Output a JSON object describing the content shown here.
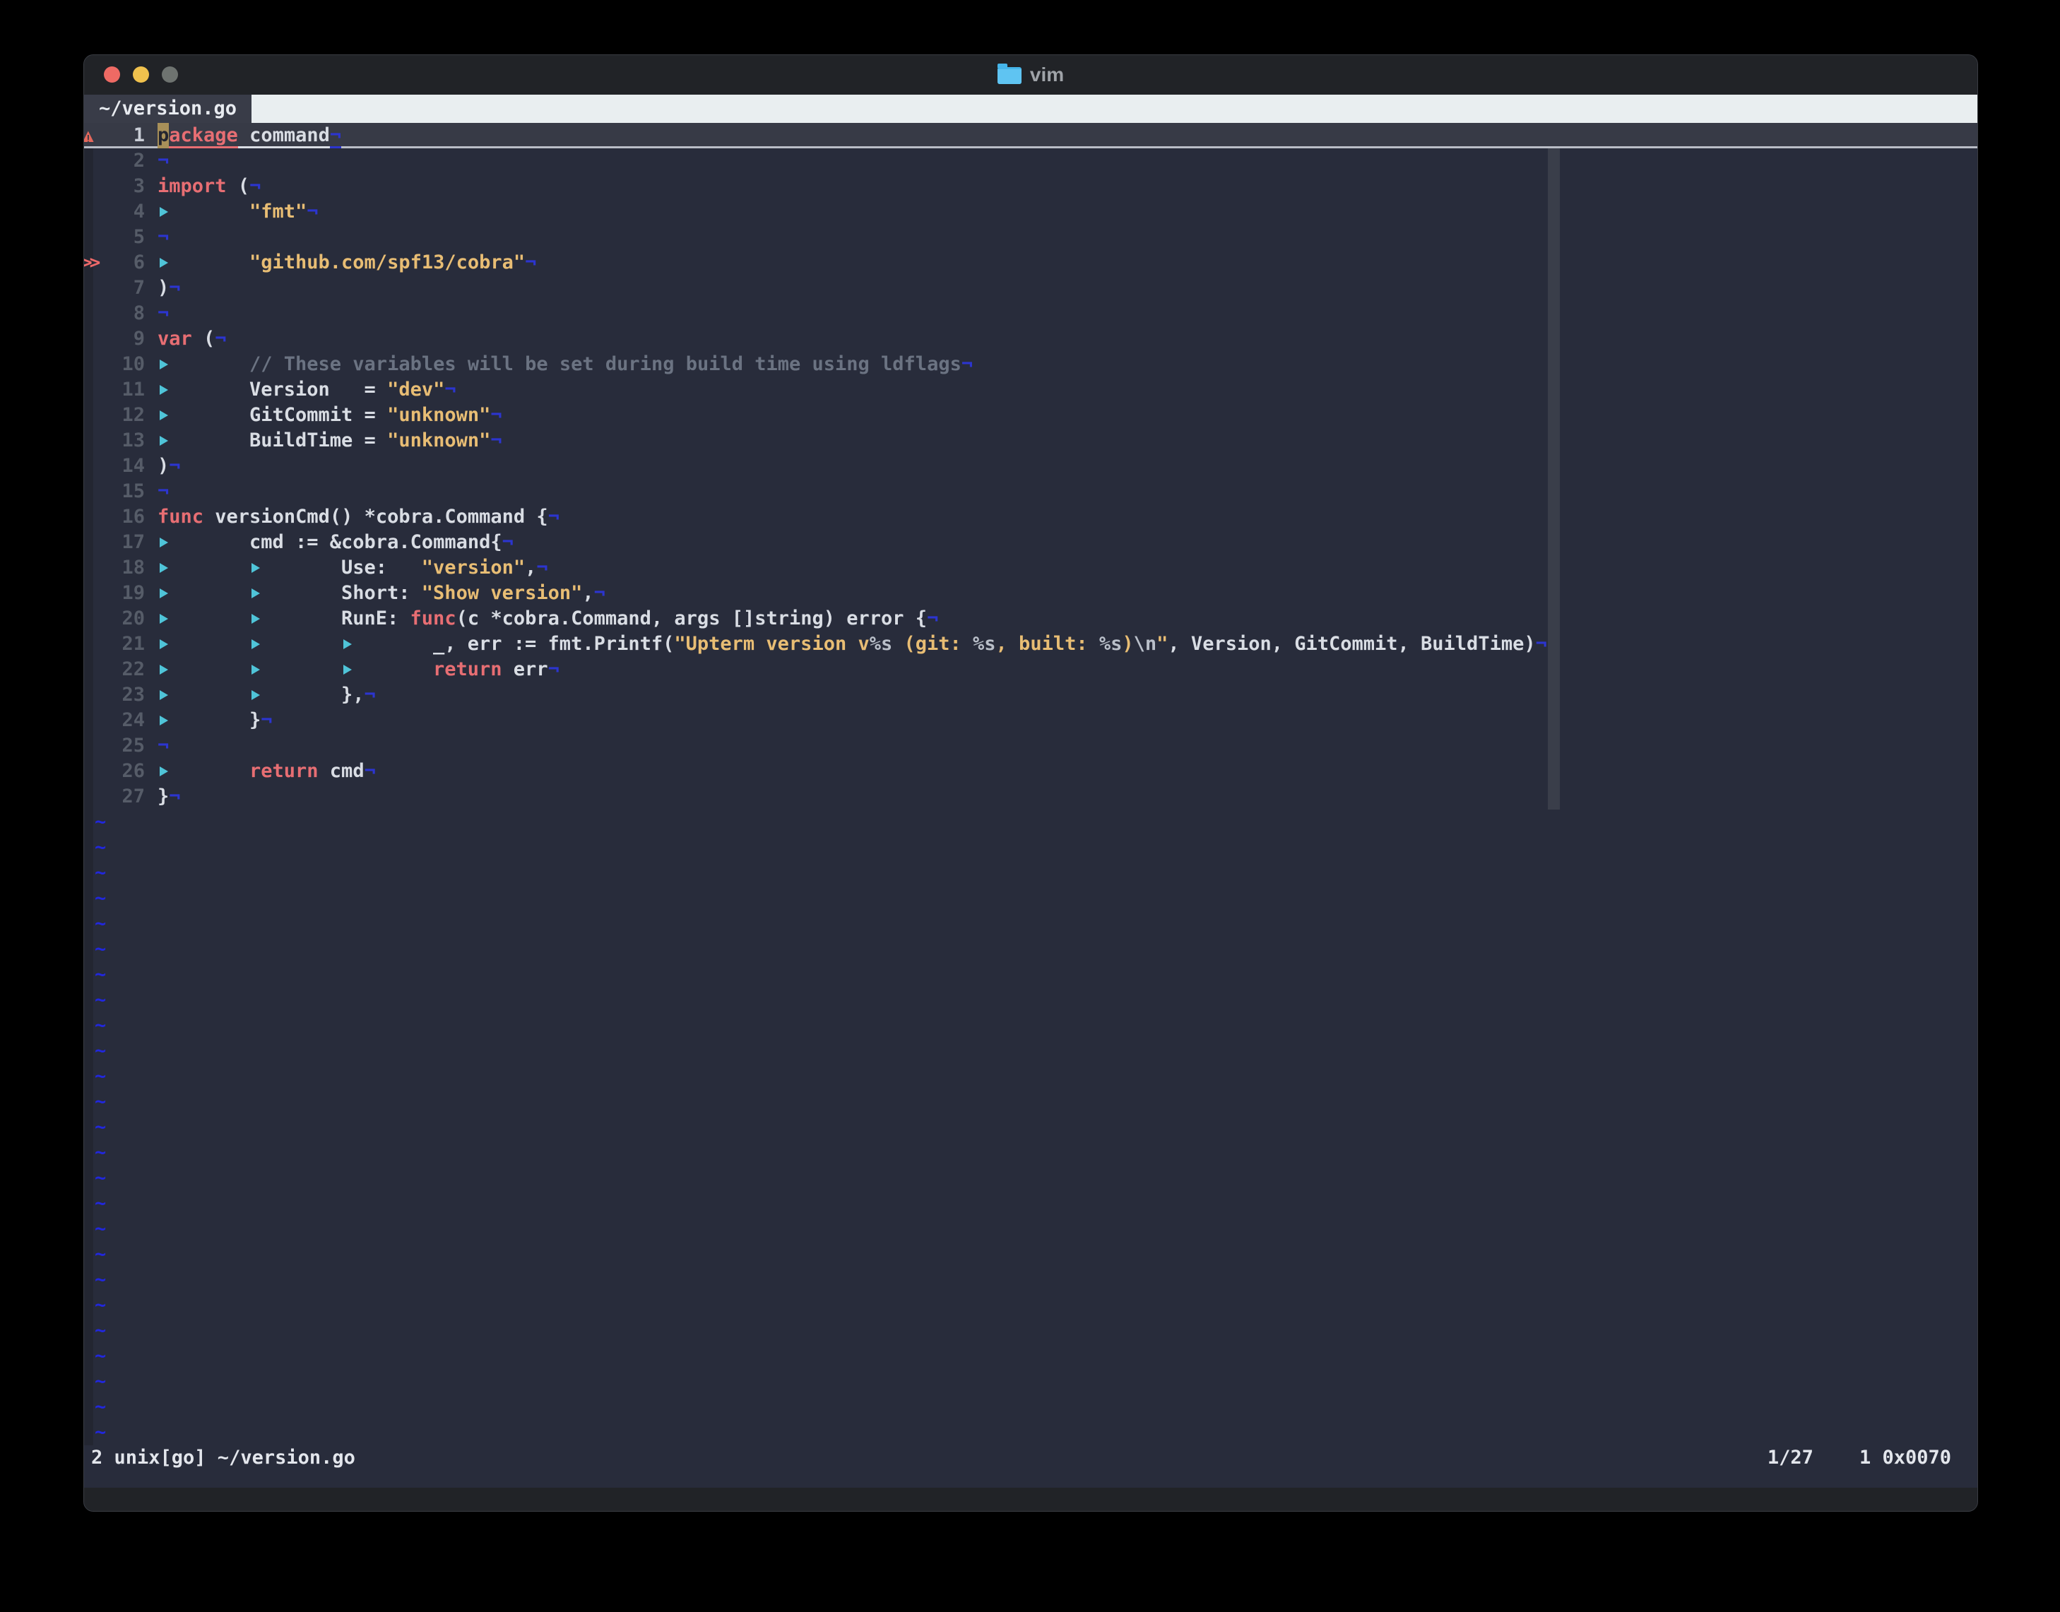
{
  "window": {
    "app_title": "vim",
    "traffic_lights": {
      "close": "#ee6a64",
      "minimize": "#f0c14d",
      "zoom": "#6e7370"
    }
  },
  "tabbar": {
    "active_tab": "~/version.go"
  },
  "statusline": {
    "left": "2 unix[go] ~/version.go",
    "right": "1/27    1 0x0070"
  },
  "editor": {
    "eol_marker": "¬",
    "tab_marker": "tab-indent-triangle",
    "empty_line_marker": "~",
    "empty_rows": 25,
    "signs": {
      "warning_line": 1,
      "changed_line": 6,
      "changed_glyph": ">>"
    },
    "lines": [
      {
        "num": 1,
        "tabs": 0,
        "cursorline": true,
        "sign": "warning",
        "segments": [
          {
            "t": "p",
            "s": "cursor"
          },
          {
            "t": "ackage",
            "s": "keyword"
          },
          {
            "t": " command",
            "s": "normal"
          }
        ]
      },
      {
        "num": 2,
        "tabs": 0,
        "segments": []
      },
      {
        "num": 3,
        "tabs": 0,
        "segments": [
          {
            "t": "import ",
            "s": "keyword"
          },
          {
            "t": "(",
            "s": "normal"
          }
        ]
      },
      {
        "num": 4,
        "tabs": 1,
        "segments": [
          {
            "t": "\"fmt\"",
            "s": "string"
          }
        ]
      },
      {
        "num": 5,
        "tabs": 0,
        "segments": []
      },
      {
        "num": 6,
        "tabs": 1,
        "sign": "changed",
        "segments": [
          {
            "t": "\"github.com/spf13/cobra\"",
            "s": "string"
          }
        ]
      },
      {
        "num": 7,
        "tabs": 0,
        "segments": [
          {
            "t": ")",
            "s": "normal"
          }
        ]
      },
      {
        "num": 8,
        "tabs": 0,
        "segments": []
      },
      {
        "num": 9,
        "tabs": 0,
        "segments": [
          {
            "t": "var ",
            "s": "keyword"
          },
          {
            "t": "(",
            "s": "normal"
          }
        ]
      },
      {
        "num": 10,
        "tabs": 1,
        "segments": [
          {
            "t": "// These variables will be set during build time using ldflags",
            "s": "comment"
          }
        ]
      },
      {
        "num": 11,
        "tabs": 1,
        "segments": [
          {
            "t": "Version   = ",
            "s": "normal"
          },
          {
            "t": "\"dev\"",
            "s": "string"
          }
        ]
      },
      {
        "num": 12,
        "tabs": 1,
        "segments": [
          {
            "t": "GitCommit = ",
            "s": "normal"
          },
          {
            "t": "\"unknown\"",
            "s": "string"
          }
        ]
      },
      {
        "num": 13,
        "tabs": 1,
        "segments": [
          {
            "t": "BuildTime = ",
            "s": "normal"
          },
          {
            "t": "\"unknown\"",
            "s": "string"
          }
        ]
      },
      {
        "num": 14,
        "tabs": 0,
        "segments": [
          {
            "t": ")",
            "s": "normal"
          }
        ]
      },
      {
        "num": 15,
        "tabs": 0,
        "segments": []
      },
      {
        "num": 16,
        "tabs": 0,
        "segments": [
          {
            "t": "func",
            "s": "keyword"
          },
          {
            "t": " versionCmd() *cobra.Command {",
            "s": "normal"
          }
        ]
      },
      {
        "num": 17,
        "tabs": 1,
        "segments": [
          {
            "t": "cmd := &cobra.Command{",
            "s": "normal"
          }
        ]
      },
      {
        "num": 18,
        "tabs": 2,
        "segments": [
          {
            "t": "Use:   ",
            "s": "normal"
          },
          {
            "t": "\"version\"",
            "s": "string"
          },
          {
            "t": ",",
            "s": "normal"
          }
        ]
      },
      {
        "num": 19,
        "tabs": 2,
        "segments": [
          {
            "t": "Short: ",
            "s": "normal"
          },
          {
            "t": "\"Show version\"",
            "s": "string"
          },
          {
            "t": ",",
            "s": "normal"
          }
        ]
      },
      {
        "num": 20,
        "tabs": 2,
        "segments": [
          {
            "t": "RunE: ",
            "s": "normal"
          },
          {
            "t": "func",
            "s": "keyword"
          },
          {
            "t": "(c *cobra.Command, args []string) error {",
            "s": "normal"
          }
        ]
      },
      {
        "num": 21,
        "tabs": 3,
        "segments": [
          {
            "t": "_, err := fmt.Printf(",
            "s": "normal"
          },
          {
            "t": "\"Upterm version v",
            "s": "string"
          },
          {
            "t": "%s",
            "s": "special"
          },
          {
            "t": " (git: ",
            "s": "string"
          },
          {
            "t": "%s",
            "s": "special"
          },
          {
            "t": ", built: ",
            "s": "string"
          },
          {
            "t": "%s",
            "s": "special"
          },
          {
            "t": ")",
            "s": "string"
          },
          {
            "t": "\\n",
            "s": "special"
          },
          {
            "t": "\"",
            "s": "string"
          },
          {
            "t": ", Version, GitCommit, BuildTime)",
            "s": "normal"
          }
        ]
      },
      {
        "num": 22,
        "tabs": 3,
        "segments": [
          {
            "t": "return",
            "s": "keyword"
          },
          {
            "t": " err",
            "s": "normal"
          }
        ]
      },
      {
        "num": 23,
        "tabs": 2,
        "segments": [
          {
            "t": "},",
            "s": "normal"
          }
        ]
      },
      {
        "num": 24,
        "tabs": 1,
        "segments": [
          {
            "t": "}",
            "s": "normal"
          }
        ]
      },
      {
        "num": 25,
        "tabs": 0,
        "segments": []
      },
      {
        "num": 26,
        "tabs": 1,
        "segments": [
          {
            "t": "return",
            "s": "keyword"
          },
          {
            "t": " cmd",
            "s": "normal"
          }
        ]
      },
      {
        "num": 27,
        "tabs": 0,
        "segments": [
          {
            "t": "}",
            "s": "normal"
          }
        ]
      }
    ]
  },
  "colors": {
    "background": "#282c3b",
    "chrome": "#212327",
    "tabbar_light": "#e9eef0",
    "tab_active_bg": "#393c48",
    "cursorline_bg": "#373a46",
    "colorcolumn": "#3a3e4a",
    "line_number": "#565c68",
    "normal_text": "#d9dde4",
    "keyword": "#e76e73",
    "string": "#e8bd74",
    "special": "#b9bfc9",
    "comment": "#6b7382",
    "eol_marker": "#2c35cf",
    "tab_marker": "#4fc4d8",
    "tilde": "#2127dc",
    "sign_red": "#ef6a6a",
    "cursor_block": "#a89059"
  }
}
